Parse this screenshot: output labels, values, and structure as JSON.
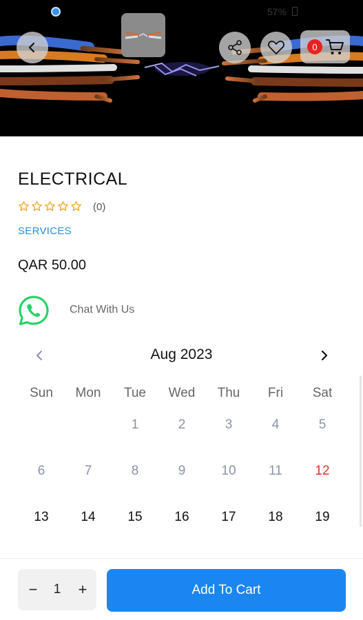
{
  "status_bar": {
    "battery_text": "57%"
  },
  "header": {
    "cart_count": "0",
    "icons": [
      "back-arrow-icon",
      "share-icon",
      "heart-icon",
      "cart-icon"
    ]
  },
  "product": {
    "title": "ELECTRICAL",
    "rating_stars": 0,
    "rating_max": 5,
    "review_count": "(0)",
    "category": "SERVICES",
    "price": "QAR 50.00",
    "chat_label": "Chat With Us"
  },
  "calendar": {
    "month_label": "Aug 2023",
    "weekdays": [
      "Sun",
      "Mon",
      "Tue",
      "Wed",
      "Thu",
      "Fri",
      "Sat"
    ],
    "days": [
      {
        "label": "",
        "state": "empty"
      },
      {
        "label": "",
        "state": "empty"
      },
      {
        "label": "1",
        "state": "past"
      },
      {
        "label": "2",
        "state": "past"
      },
      {
        "label": "3",
        "state": "past"
      },
      {
        "label": "4",
        "state": "past"
      },
      {
        "label": "5",
        "state": "past"
      },
      {
        "label": "6",
        "state": "past"
      },
      {
        "label": "7",
        "state": "past"
      },
      {
        "label": "8",
        "state": "past"
      },
      {
        "label": "9",
        "state": "past"
      },
      {
        "label": "10",
        "state": "past"
      },
      {
        "label": "11",
        "state": "past"
      },
      {
        "label": "12",
        "state": "today"
      },
      {
        "label": "13",
        "state": "future"
      },
      {
        "label": "14",
        "state": "future"
      },
      {
        "label": "15",
        "state": "future"
      },
      {
        "label": "16",
        "state": "future"
      },
      {
        "label": "17",
        "state": "future"
      },
      {
        "label": "18",
        "state": "future"
      },
      {
        "label": "19",
        "state": "future"
      }
    ]
  },
  "bottom": {
    "qty_minus": "−",
    "quantity": "1",
    "qty_plus": "+",
    "add_to_cart_label": "Add To Cart"
  },
  "colors": {
    "accent": "#1b86f2",
    "category": "#2d8fd5",
    "star": "#f0a020",
    "badge": "#e8231f",
    "today": "#d23a2a",
    "whatsapp": "#25d366"
  }
}
